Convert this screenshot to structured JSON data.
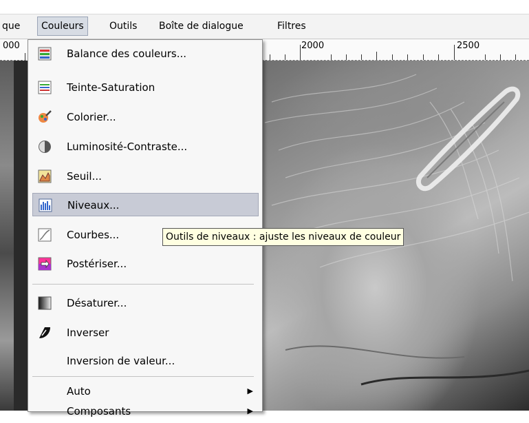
{
  "menubar": {
    "items": [
      {
        "label": "que"
      },
      {
        "label": "Couleurs"
      },
      {
        "label": "Outils"
      },
      {
        "label": "Boîte de dialogue"
      },
      {
        "label": "Filtres"
      }
    ]
  },
  "ruler": {
    "labels": [
      "000",
      "2000",
      "2500"
    ]
  },
  "menu": {
    "items": [
      {
        "label": "Balance des couleurs...",
        "icon": "color-balance-icon"
      },
      {
        "label": "Teinte-Saturation",
        "icon": "hue-saturation-icon"
      },
      {
        "label": "Colorier...",
        "icon": "colorize-icon"
      },
      {
        "label": "Luminosité-Contraste...",
        "icon": "brightness-contrast-icon"
      },
      {
        "label": "Seuil...",
        "icon": "threshold-icon"
      },
      {
        "label": "Niveaux...",
        "icon": "levels-icon"
      },
      {
        "label": "Courbes...",
        "icon": "curves-icon"
      },
      {
        "label": "Postériser...",
        "icon": "posterize-icon"
      },
      {
        "label": "Désaturer...",
        "icon": "desaturate-icon"
      },
      {
        "label": "Inverser",
        "icon": "invert-icon"
      },
      {
        "label": "Inversion de valeur...",
        "icon": ""
      },
      {
        "label": "Auto",
        "icon": "",
        "submenu": true
      },
      {
        "label": "Composants",
        "icon": "",
        "submenu": true
      }
    ]
  },
  "tooltip": {
    "text": "Outils de niveaux : ajuste les niveaux de couleur"
  },
  "colors": {
    "menu_bg": "#f7f7f7",
    "highlight": "#c8cbd6",
    "tooltip_bg": "#ffffe1"
  }
}
